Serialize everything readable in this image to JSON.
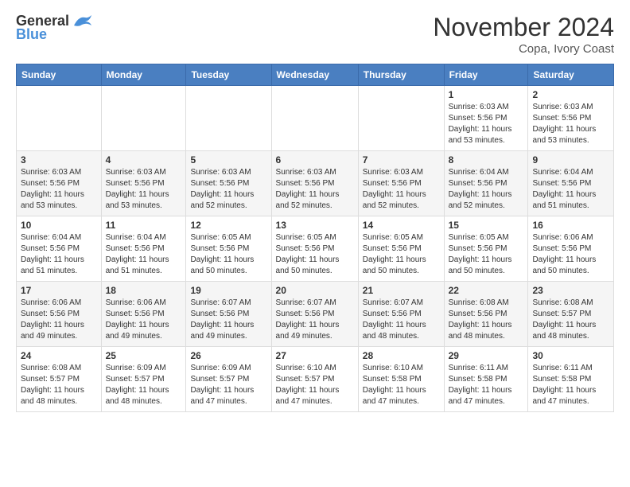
{
  "header": {
    "logo_general": "General",
    "logo_blue": "Blue",
    "month_title": "November 2024",
    "location": "Copa, Ivory Coast"
  },
  "weekdays": [
    "Sunday",
    "Monday",
    "Tuesday",
    "Wednesday",
    "Thursday",
    "Friday",
    "Saturday"
  ],
  "weeks": [
    [
      {
        "day": "",
        "info": ""
      },
      {
        "day": "",
        "info": ""
      },
      {
        "day": "",
        "info": ""
      },
      {
        "day": "",
        "info": ""
      },
      {
        "day": "",
        "info": ""
      },
      {
        "day": "1",
        "info": "Sunrise: 6:03 AM\nSunset: 5:56 PM\nDaylight: 11 hours\nand 53 minutes."
      },
      {
        "day": "2",
        "info": "Sunrise: 6:03 AM\nSunset: 5:56 PM\nDaylight: 11 hours\nand 53 minutes."
      }
    ],
    [
      {
        "day": "3",
        "info": "Sunrise: 6:03 AM\nSunset: 5:56 PM\nDaylight: 11 hours\nand 53 minutes."
      },
      {
        "day": "4",
        "info": "Sunrise: 6:03 AM\nSunset: 5:56 PM\nDaylight: 11 hours\nand 53 minutes."
      },
      {
        "day": "5",
        "info": "Sunrise: 6:03 AM\nSunset: 5:56 PM\nDaylight: 11 hours\nand 52 minutes."
      },
      {
        "day": "6",
        "info": "Sunrise: 6:03 AM\nSunset: 5:56 PM\nDaylight: 11 hours\nand 52 minutes."
      },
      {
        "day": "7",
        "info": "Sunrise: 6:03 AM\nSunset: 5:56 PM\nDaylight: 11 hours\nand 52 minutes."
      },
      {
        "day": "8",
        "info": "Sunrise: 6:04 AM\nSunset: 5:56 PM\nDaylight: 11 hours\nand 52 minutes."
      },
      {
        "day": "9",
        "info": "Sunrise: 6:04 AM\nSunset: 5:56 PM\nDaylight: 11 hours\nand 51 minutes."
      }
    ],
    [
      {
        "day": "10",
        "info": "Sunrise: 6:04 AM\nSunset: 5:56 PM\nDaylight: 11 hours\nand 51 minutes."
      },
      {
        "day": "11",
        "info": "Sunrise: 6:04 AM\nSunset: 5:56 PM\nDaylight: 11 hours\nand 51 minutes."
      },
      {
        "day": "12",
        "info": "Sunrise: 6:05 AM\nSunset: 5:56 PM\nDaylight: 11 hours\nand 50 minutes."
      },
      {
        "day": "13",
        "info": "Sunrise: 6:05 AM\nSunset: 5:56 PM\nDaylight: 11 hours\nand 50 minutes."
      },
      {
        "day": "14",
        "info": "Sunrise: 6:05 AM\nSunset: 5:56 PM\nDaylight: 11 hours\nand 50 minutes."
      },
      {
        "day": "15",
        "info": "Sunrise: 6:05 AM\nSunset: 5:56 PM\nDaylight: 11 hours\nand 50 minutes."
      },
      {
        "day": "16",
        "info": "Sunrise: 6:06 AM\nSunset: 5:56 PM\nDaylight: 11 hours\nand 50 minutes."
      }
    ],
    [
      {
        "day": "17",
        "info": "Sunrise: 6:06 AM\nSunset: 5:56 PM\nDaylight: 11 hours\nand 49 minutes."
      },
      {
        "day": "18",
        "info": "Sunrise: 6:06 AM\nSunset: 5:56 PM\nDaylight: 11 hours\nand 49 minutes."
      },
      {
        "day": "19",
        "info": "Sunrise: 6:07 AM\nSunset: 5:56 PM\nDaylight: 11 hours\nand 49 minutes."
      },
      {
        "day": "20",
        "info": "Sunrise: 6:07 AM\nSunset: 5:56 PM\nDaylight: 11 hours\nand 49 minutes."
      },
      {
        "day": "21",
        "info": "Sunrise: 6:07 AM\nSunset: 5:56 PM\nDaylight: 11 hours\nand 48 minutes."
      },
      {
        "day": "22",
        "info": "Sunrise: 6:08 AM\nSunset: 5:56 PM\nDaylight: 11 hours\nand 48 minutes."
      },
      {
        "day": "23",
        "info": "Sunrise: 6:08 AM\nSunset: 5:57 PM\nDaylight: 11 hours\nand 48 minutes."
      }
    ],
    [
      {
        "day": "24",
        "info": "Sunrise: 6:08 AM\nSunset: 5:57 PM\nDaylight: 11 hours\nand 48 minutes."
      },
      {
        "day": "25",
        "info": "Sunrise: 6:09 AM\nSunset: 5:57 PM\nDaylight: 11 hours\nand 48 minutes."
      },
      {
        "day": "26",
        "info": "Sunrise: 6:09 AM\nSunset: 5:57 PM\nDaylight: 11 hours\nand 47 minutes."
      },
      {
        "day": "27",
        "info": "Sunrise: 6:10 AM\nSunset: 5:57 PM\nDaylight: 11 hours\nand 47 minutes."
      },
      {
        "day": "28",
        "info": "Sunrise: 6:10 AM\nSunset: 5:58 PM\nDaylight: 11 hours\nand 47 minutes."
      },
      {
        "day": "29",
        "info": "Sunrise: 6:11 AM\nSunset: 5:58 PM\nDaylight: 11 hours\nand 47 minutes."
      },
      {
        "day": "30",
        "info": "Sunrise: 6:11 AM\nSunset: 5:58 PM\nDaylight: 11 hours\nand 47 minutes."
      }
    ]
  ]
}
